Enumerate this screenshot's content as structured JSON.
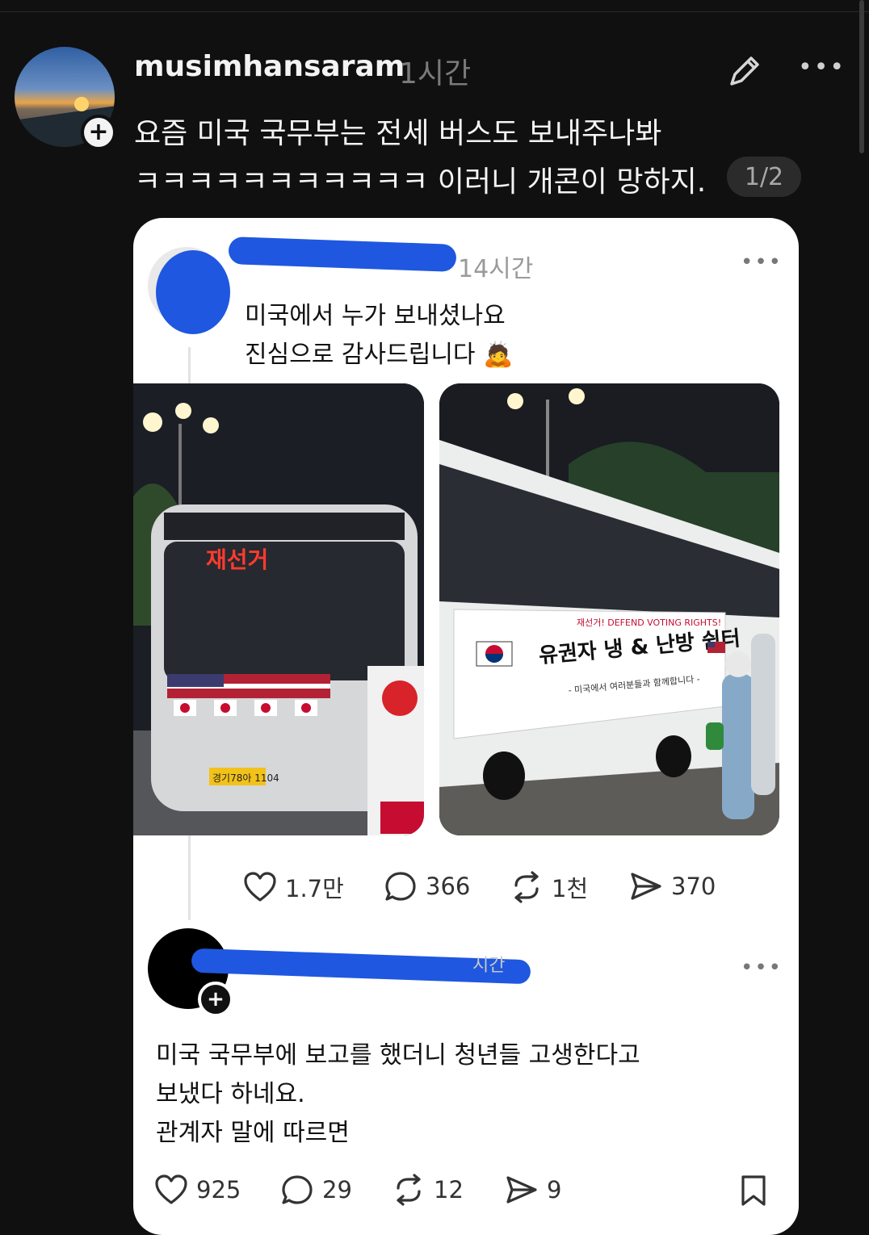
{
  "post": {
    "username": "musimhansaram",
    "time": "1시간",
    "text_line1": "요즘 미국 국무부는 전세 버스도 보내주나봐",
    "text_line2": "ㅋㅋㅋㅋㅋㅋㅋㅋㅋㅋㅋ 이러니 개콘이 망하지.",
    "pager": "1/2"
  },
  "embedded": {
    "post1": {
      "time": "14시간",
      "line1": "미국에서 누가 보내셨나요",
      "line2": "진심으로 감사드립니다 🙇",
      "photo1_sign": "재선거",
      "photo1_plate": "경기78아 1104",
      "photo2_banner_top": "재선거! DEFEND VOTING RIGHTS!",
      "photo2_banner_main": "유권자 냉 & 난방 쉼터",
      "photo2_banner_sub": "- 미국에서 여러분들과 함께합니다 -",
      "likes": "1.7만",
      "comments": "366",
      "reposts": "1천",
      "shares": "370"
    },
    "post2": {
      "time": "시간",
      "line1": "미국 국무부에 보고를 했더니 청년들 고생한다고",
      "line2": "보냈다 하네요.",
      "line3": "관계자 말에 따르면",
      "likes": "925",
      "comments": "29",
      "reposts": "12",
      "shares": "9"
    }
  },
  "icons": {
    "edit": "pencil-icon",
    "more": "more-options-icon",
    "follow": "plus-icon",
    "like": "heart-icon",
    "comment": "comment-bubble-icon",
    "repost": "repost-icon",
    "share": "send-icon",
    "bookmark": "bookmark-icon"
  },
  "colors": {
    "background": "#101010",
    "card": "#ffffff",
    "redaction": "#1f57e0"
  }
}
